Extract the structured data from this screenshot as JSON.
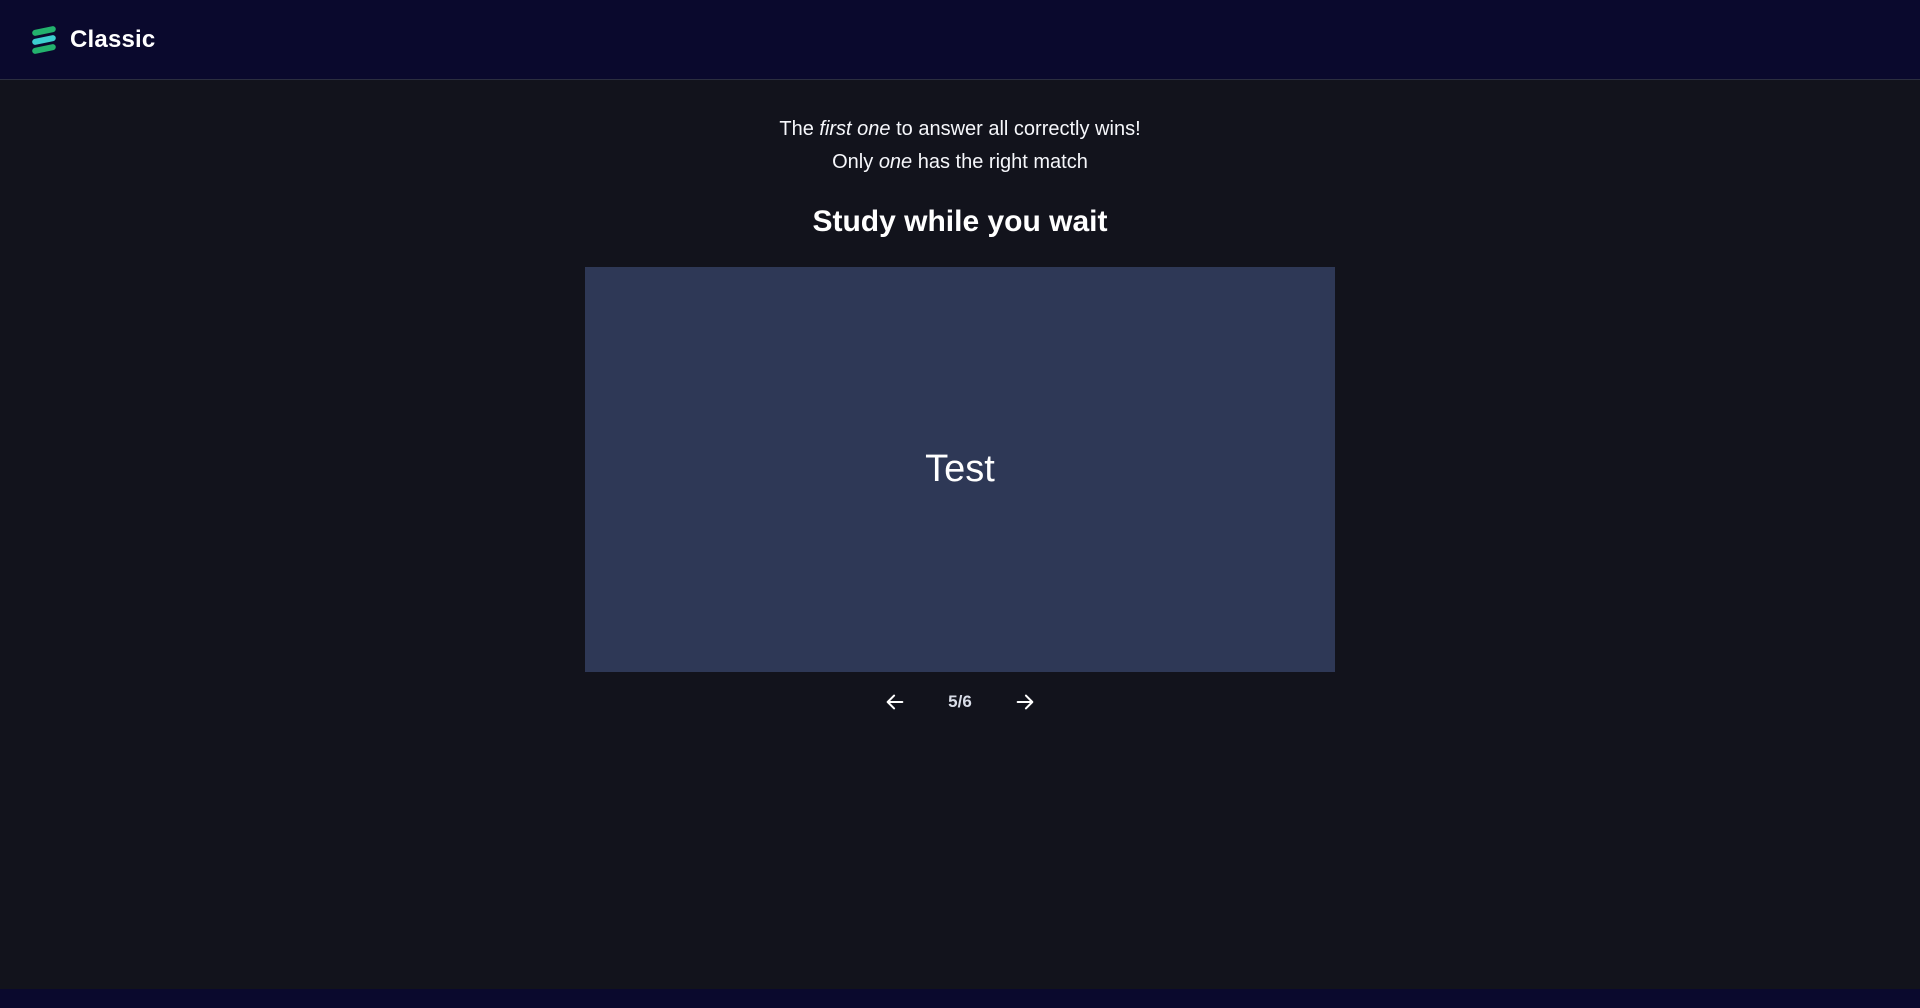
{
  "header": {
    "mode_title": "Classic",
    "logo_icon": "stacked-lines-logo-icon",
    "logo_color": "#23b26d"
  },
  "rules": {
    "line1_prefix": "The ",
    "line1_emphasis": "first one",
    "line1_suffix": " to answer all correctly wins!",
    "line2_prefix": "Only ",
    "line2_emphasis": "one",
    "line2_suffix": " has the right match"
  },
  "study": {
    "title": "Study while you wait",
    "card_text": "Test",
    "counter": "5/6",
    "prev_icon": "arrow-left-icon",
    "next_icon": "arrow-right-icon"
  },
  "colors": {
    "header_bg": "#0a092d",
    "page_bg": "#12131c",
    "card_bg": "#2e3856"
  }
}
